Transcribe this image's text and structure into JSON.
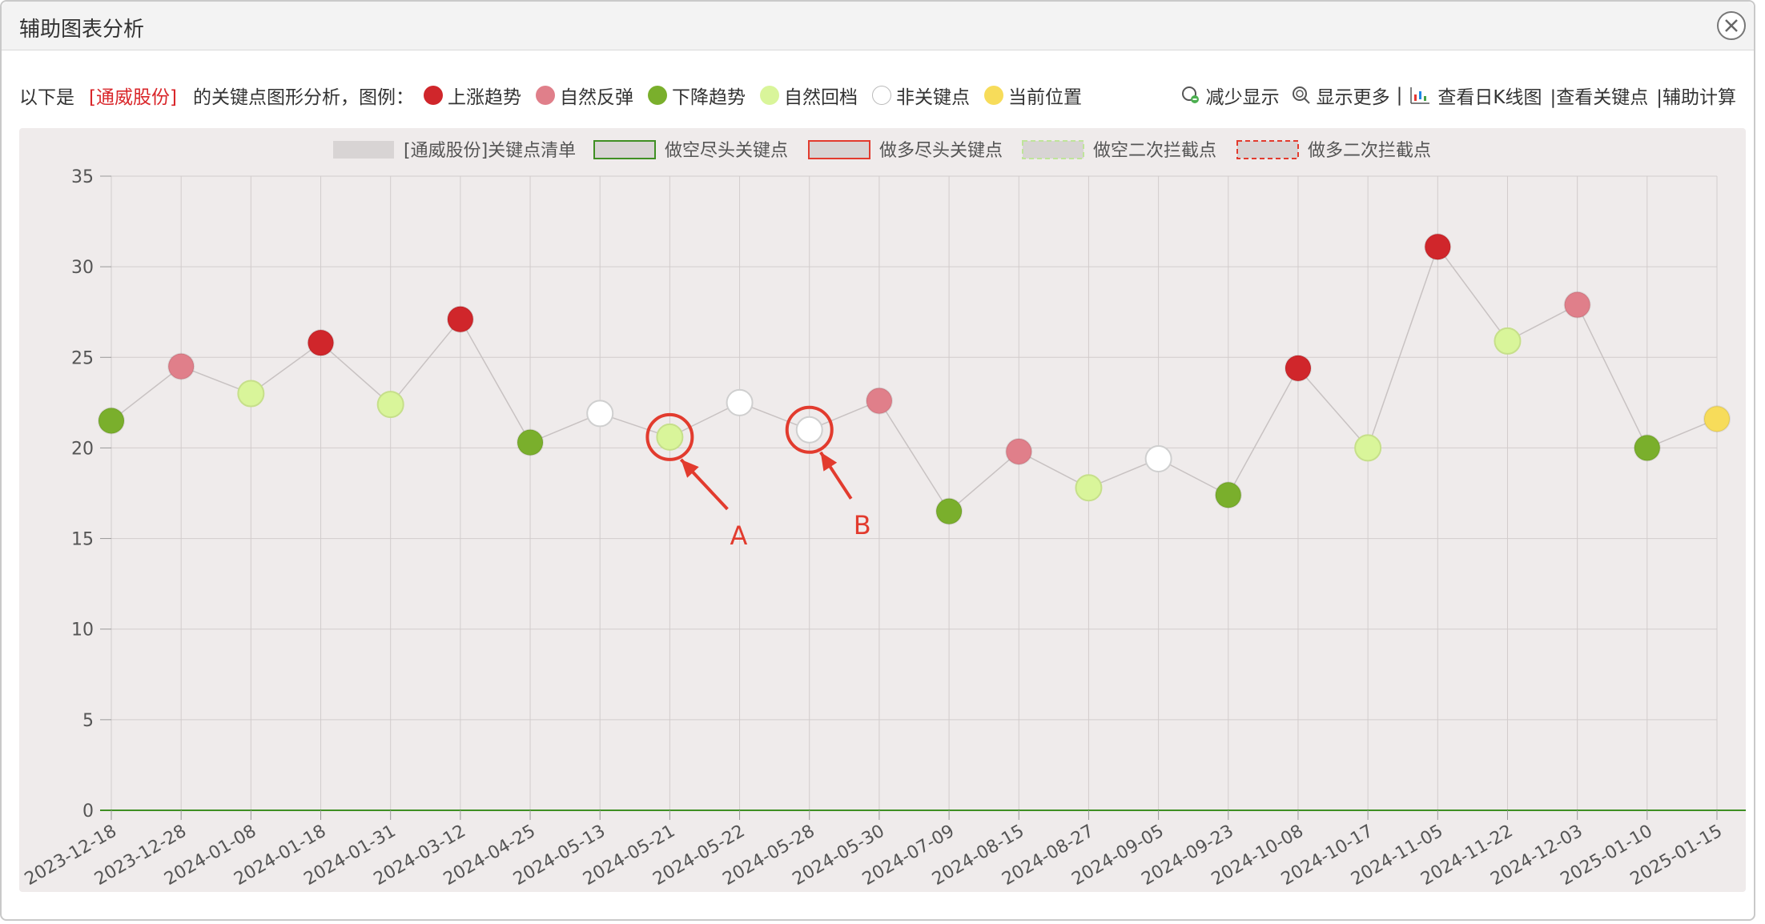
{
  "window": {
    "title": "辅助图表分析"
  },
  "toolbar": {
    "prefix": "以下是",
    "stock": "[通威股份]",
    "suffix": "的关键点图形分析，图例：",
    "legend": [
      {
        "label": "上涨趋势",
        "color": "#d0262b"
      },
      {
        "label": "自然反弹",
        "color": "#e07f8a"
      },
      {
        "label": "下降趋势",
        "color": "#7aaf2c"
      },
      {
        "label": "自然回档",
        "color": "#d9f59a"
      },
      {
        "label": "非关键点",
        "color": "#ffffff"
      },
      {
        "label": "当前位置",
        "color": "#f7dc5a"
      }
    ],
    "tools": {
      "less": "减少显示",
      "more": "显示更多",
      "bar1": "|",
      "kline": "查看日K线图",
      "keypoints": "|查看关键点",
      "calc": "|辅助计算"
    }
  },
  "chart_legend": [
    {
      "label": "[通威股份]关键点清单",
      "style": "solid-gray"
    },
    {
      "label": "做空尽头关键点",
      "style": "green-border"
    },
    {
      "label": "做多尽头关键点",
      "style": "red-border"
    },
    {
      "label": "做空二次拦截点",
      "style": "green-dashed"
    },
    {
      "label": "做多二次拦截点",
      "style": "red-dashed"
    }
  ],
  "chart_data": {
    "type": "scatter",
    "ylim": [
      0,
      35
    ],
    "yticks": [
      0,
      5,
      10,
      15,
      20,
      25,
      30,
      35
    ],
    "x": [
      "2023-12-18",
      "2023-12-28",
      "2024-01-08",
      "2024-01-18",
      "2024-01-31",
      "2024-03-12",
      "2024-04-25",
      "2024-05-13",
      "2024-05-21",
      "2024-05-22",
      "2024-05-28",
      "2024-05-30",
      "2024-07-09",
      "2024-08-15",
      "2024-08-27",
      "2024-09-05",
      "2024-09-23",
      "2024-10-08",
      "2024-10-17",
      "2024-11-05",
      "2024-11-22",
      "2024-12-03",
      "2025-01-10",
      "2025-01-15"
    ],
    "y": [
      21.5,
      24.5,
      23.0,
      25.8,
      22.4,
      27.1,
      20.3,
      21.9,
      20.6,
      22.5,
      21.0,
      22.6,
      16.5,
      19.8,
      17.8,
      19.4,
      17.4,
      24.4,
      20.0,
      31.1,
      25.9,
      27.9,
      20.0,
      21.6
    ],
    "types": [
      "down",
      "rebound",
      "pullback",
      "up",
      "pullback",
      "up",
      "down",
      "none",
      "pullback",
      "none",
      "none",
      "rebound",
      "down",
      "rebound",
      "pullback",
      "none",
      "down",
      "up",
      "pullback",
      "up",
      "pullback",
      "rebound",
      "down",
      "current"
    ],
    "grid": true,
    "legend_position": "top-center",
    "colors": {
      "up": "#d0262b",
      "rebound": "#e07f8a",
      "down": "#7aaf2c",
      "pullback": "#d9f59a",
      "none": "#ffffff",
      "current": "#f7dc5a"
    },
    "zero_line_color": "#3f8f23"
  },
  "annotations": [
    {
      "label": "A",
      "target_index": 8,
      "color": "#e23b2e"
    },
    {
      "label": "B",
      "target_index": 10,
      "color": "#e23b2e"
    }
  ]
}
